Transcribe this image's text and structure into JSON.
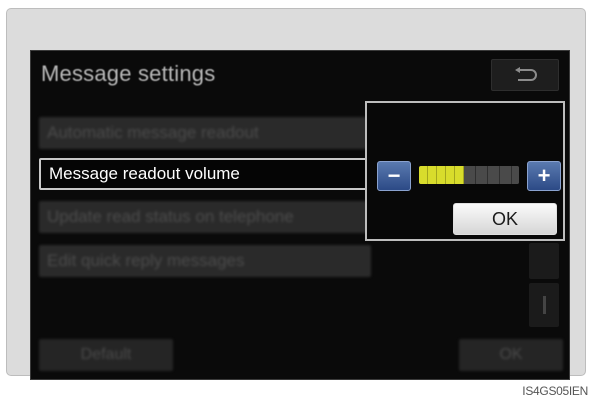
{
  "screen": {
    "title": "Message settings"
  },
  "menu": {
    "items": [
      {
        "label": "Automatic message readout"
      },
      {
        "label": "Message readout volume"
      },
      {
        "label": "Update read status on telephone"
      },
      {
        "label": "Edit quick reply messages"
      }
    ]
  },
  "footer": {
    "default_label": "Default",
    "ok_label": "OK"
  },
  "volume_popup": {
    "ok_label": "OK",
    "minus_glyph": "−",
    "plus_glyph": "+",
    "level": 0.45
  },
  "colors": {
    "level_fill": "#d8dc2c",
    "volume_button": "#3d5f9e",
    "background": "#0a0a0a"
  },
  "icons": {
    "back": "back-arrow-icon",
    "minus": "minus-icon",
    "plus": "plus-icon"
  },
  "caption": "IS4GS05IEN"
}
